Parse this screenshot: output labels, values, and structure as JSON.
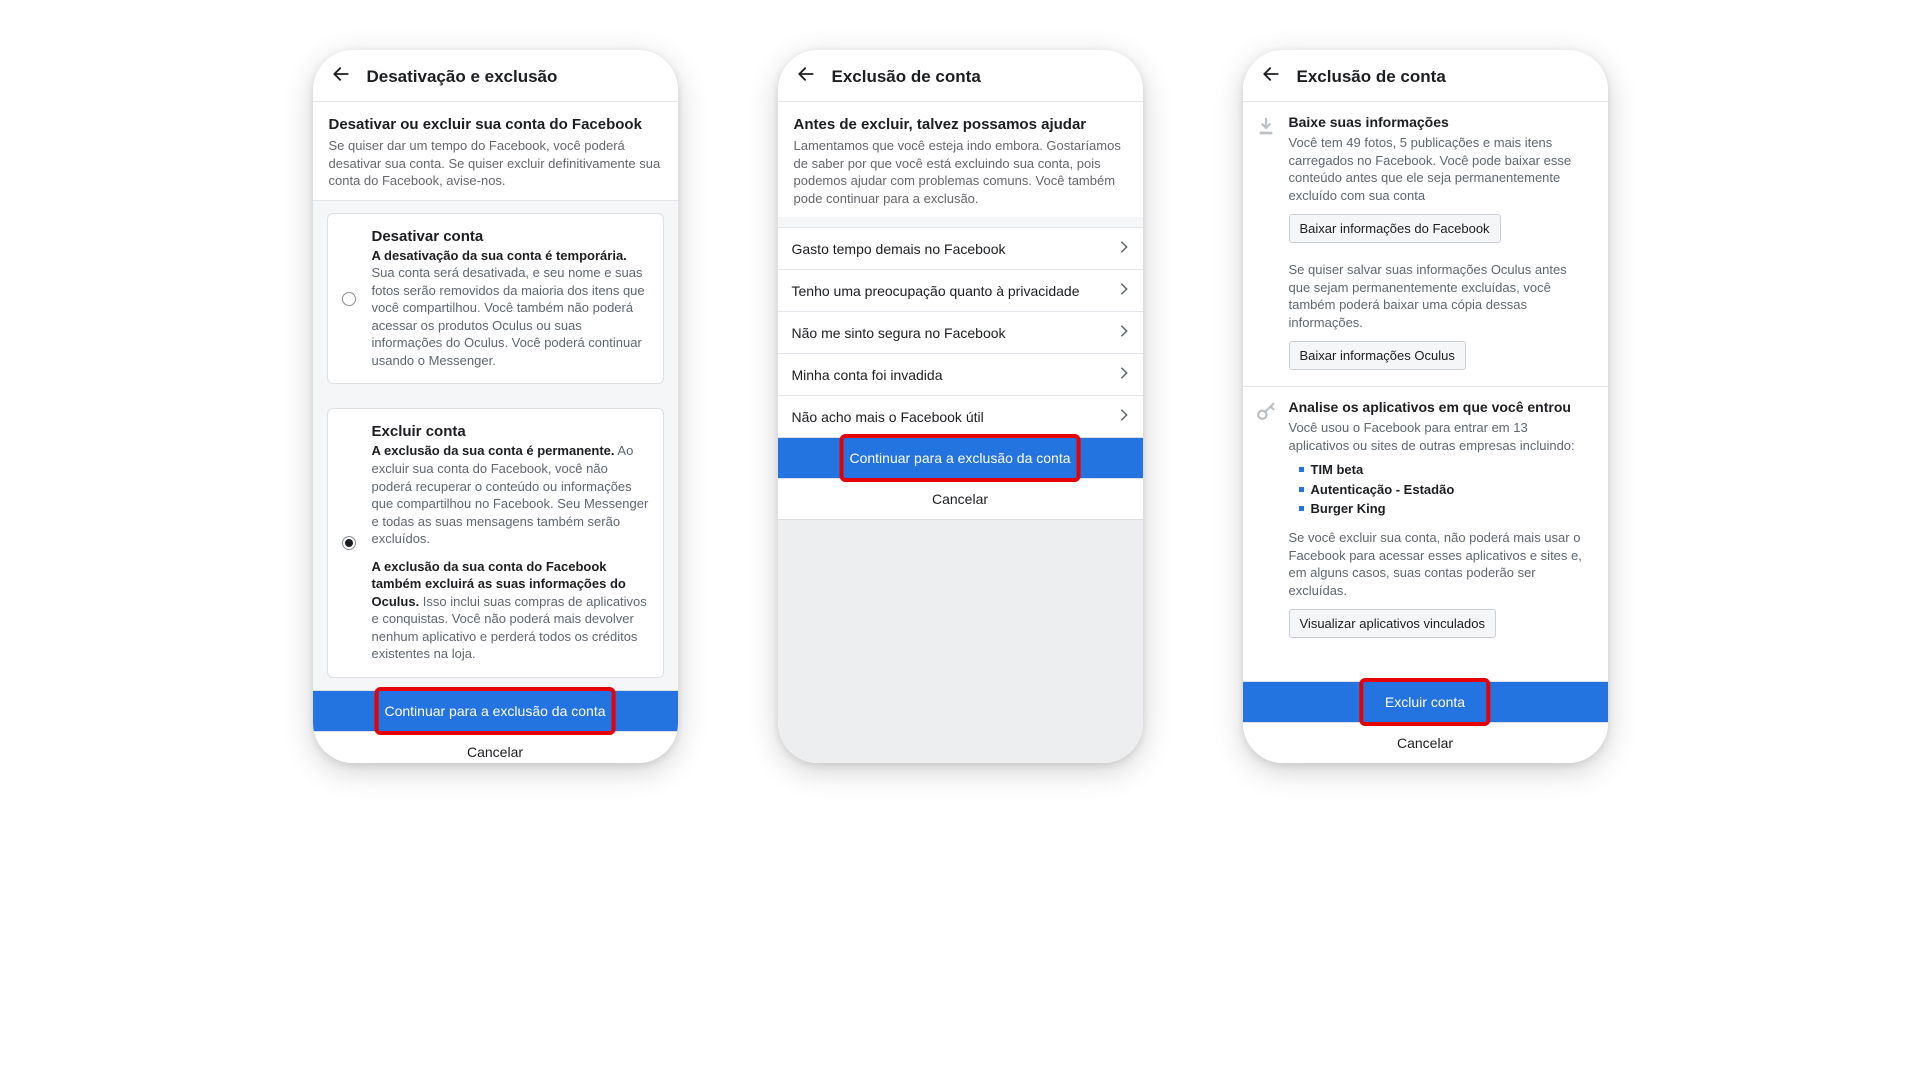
{
  "colors": {
    "primary": "#2374e1",
    "highlight": "#e60000"
  },
  "screen1": {
    "title": "Desativação e exclusão",
    "heading": "Desativar ou excluir sua conta do Facebook",
    "sub": "Se quiser dar um tempo do Facebook, você poderá desativar sua conta. Se quiser excluir definitivamente sua conta do Facebook, avise-nos.",
    "option1": {
      "title": "Desativar conta",
      "bold": "A desativação da sua conta é temporária.",
      "rest": " Sua conta será desativada, e seu nome e suas fotos serão removidos da maioria dos itens que você compartilhou. Você também não poderá acessar os produtos Oculus ou suas informações do Oculus. Você poderá continuar usando o Messenger."
    },
    "option2": {
      "title": "Excluir conta",
      "p1bold": "A exclusão da sua conta é permanente.",
      "p1rest": " Ao excluir sua conta do Facebook, você não poderá recuperar o conteúdo ou informações que compartilhou no Facebook. Seu Messenger e todas as suas mensagens também serão excluídos.",
      "p2bold": "A exclusão da sua conta do Facebook também excluirá as suas informações do Oculus.",
      "p2rest": " Isso inclui suas compras de aplicativos e conquistas. Você não poderá mais devolver nenhum aplicativo e perderá todos os créditos existentes na loja."
    },
    "continue": "Continuar para a exclusão da conta",
    "cancel": "Cancelar"
  },
  "screen2": {
    "title": "Exclusão de conta",
    "heading": "Antes de excluir, talvez possamos ajudar",
    "sub": "Lamentamos que você esteja indo embora. Gostaríamos de saber por que você está excluindo sua conta, pois podemos ajudar com problemas comuns. Você também pode continuar para a exclusão.",
    "reasons": [
      "Gasto tempo demais no Facebook",
      "Tenho uma preocupação quanto à privacidade",
      "Não me sinto segura no Facebook",
      "Minha conta foi invadida",
      "Não acho mais o Facebook útil"
    ],
    "continue": "Continuar para a exclusão da conta",
    "cancel": "Cancelar"
  },
  "screen3": {
    "title": "Exclusão de conta",
    "download": {
      "title": "Baixe suas informações",
      "text": "Você tem 49 fotos, 5 publicações e mais itens carregados no Facebook. Você pode baixar esse conteúdo antes que ele seja permanentemente excluído com sua conta",
      "button": "Baixar informações do Facebook",
      "oculusText": "Se quiser salvar suas informações Oculus antes que sejam permanentemente excluídas, você também poderá baixar uma cópia dessas informações.",
      "oculusButton": "Baixar informações Oculus"
    },
    "apps": {
      "title": "Analise os aplicativos em que você entrou",
      "text": "Você usou o Facebook para entrar em 13 aplicativos ou sites de outras empresas incluindo:",
      "list": [
        "TIM beta",
        "Autenticação - Estadão",
        "Burger King"
      ],
      "warn": "Se você excluir sua conta, não poderá mais usar o Facebook para acessar esses aplicativos e sites e, em alguns casos, suas contas poderão ser excluídas.",
      "button": "Visualizar aplicativos vinculados"
    },
    "primary": "Excluir conta",
    "cancel": "Cancelar"
  }
}
